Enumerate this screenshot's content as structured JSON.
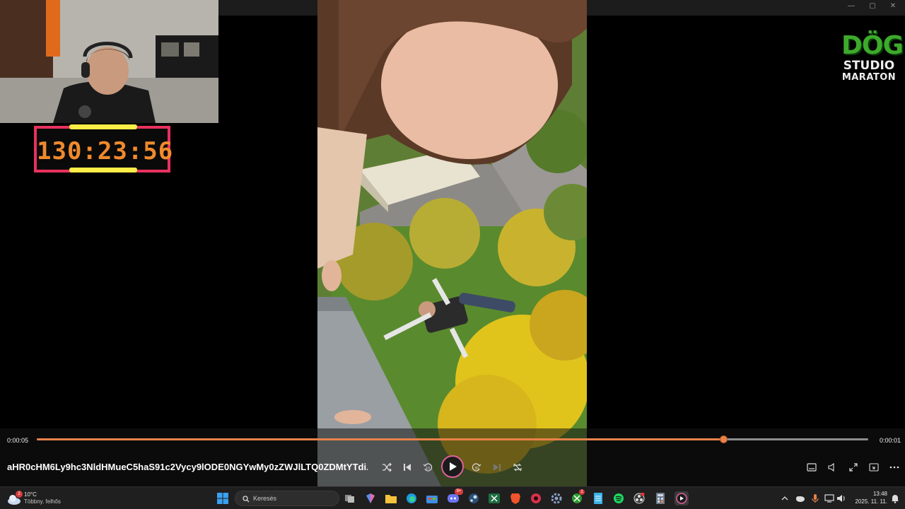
{
  "overlay": {
    "timer": "130:23:56",
    "logo": {
      "line1": "DÖG",
      "line2": "STUDIO",
      "line3": "MARATON"
    }
  },
  "player": {
    "elapsed": "0:00:05",
    "remaining": "0:00:01",
    "progress": 0.826,
    "title": "aHR0cHM6Ly9hc3NldHMueC5haS91c2Vycy9lODE0NGYwMy0zZWJlLTQ0ZDMtYTdi...",
    "controls": [
      "shuffle-icon",
      "previous-icon",
      "rewind-10-icon",
      "play-icon",
      "forward-30-icon",
      "next-icon",
      "repeat-off-icon"
    ],
    "right_controls": [
      "subtitles-icon",
      "volume-icon",
      "fullscreen-icon",
      "miniplayer-icon",
      "more-icon"
    ]
  },
  "taskbar": {
    "weather": {
      "temp": "10°C",
      "desc": "Többny. felhős",
      "badge": "2"
    },
    "search_placeholder": "Keresés",
    "discord_badge": "9+",
    "xbox_badge": "1",
    "clock": {
      "time": "13:48",
      "date": "2025. 11. 11."
    }
  },
  "colors": {
    "accent": "#e8824a",
    "timer_border": "#e8315f",
    "timer_text": "#f08a2c",
    "logo_green": "#3daa2c",
    "play_ring": "#e0609a"
  }
}
